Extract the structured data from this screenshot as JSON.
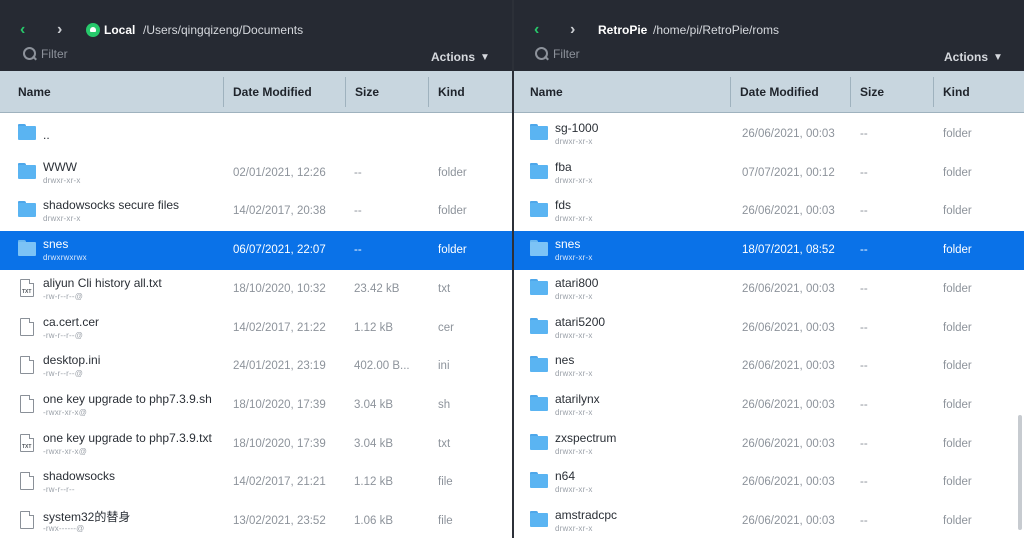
{
  "left": {
    "connection": "Local",
    "path": "/Users/qingqizeng/Documents",
    "filter_placeholder": "Filter",
    "actions_label": "Actions",
    "columns": [
      "Name",
      "Date Modified",
      "Size",
      "Kind"
    ],
    "rows": [
      {
        "type": "folder",
        "name": "..",
        "perm": "",
        "date": "",
        "size": "",
        "kind": ""
      },
      {
        "type": "folder",
        "name": "WWW",
        "perm": "drwxr-xr-x",
        "date": "02/01/2021, 12:26",
        "size": "--",
        "kind": "folder"
      },
      {
        "type": "folder",
        "name": "shadowsocks secure files",
        "perm": "drwxr-xr-x",
        "date": "14/02/2017, 20:38",
        "size": "--",
        "kind": "folder"
      },
      {
        "type": "folder",
        "name": "snes",
        "perm": "drwxrwxrwx",
        "date": "06/07/2021, 22:07",
        "size": "--",
        "kind": "folder",
        "selected": true
      },
      {
        "type": "file",
        "tag": "TXT",
        "name": "aliyun Cli history all.txt",
        "perm": "-rw-r--r--@",
        "date": "18/10/2020, 10:32",
        "size": "23.42 kB",
        "kind": "txt"
      },
      {
        "type": "file",
        "tag": "",
        "name": "ca.cert.cer",
        "perm": "-rw-r--r--@",
        "date": "14/02/2017, 21:22",
        "size": "1.12 kB",
        "kind": "cer"
      },
      {
        "type": "file",
        "tag": "",
        "name": "desktop.ini",
        "perm": "-rw-r--r--@",
        "date": "24/01/2021, 23:19",
        "size": "402.00 B...",
        "kind": "ini"
      },
      {
        "type": "file",
        "tag": "",
        "name": "one key upgrade to php7.3.9.sh",
        "perm": "-rwxr-xr-x@",
        "date": "18/10/2020, 17:39",
        "size": "3.04 kB",
        "kind": "sh"
      },
      {
        "type": "file",
        "tag": "TXT",
        "name": "one key upgrade to php7.3.9.txt",
        "perm": "-rwxr-xr-x@",
        "date": "18/10/2020, 17:39",
        "size": "3.04 kB",
        "kind": "txt"
      },
      {
        "type": "file",
        "tag": "",
        "name": "shadowsocks",
        "perm": "-rw-r--r--",
        "date": "14/02/2017, 21:21",
        "size": "1.12 kB",
        "kind": "file"
      },
      {
        "type": "file",
        "tag": "",
        "name": "system32的替身",
        "perm": "-rwx------@",
        "date": "13/02/2021, 23:52",
        "size": "1.06 kB",
        "kind": "file"
      }
    ]
  },
  "right": {
    "connection": "RetroPie",
    "path": "/home/pi/RetroPie/roms",
    "filter_placeholder": "Filter",
    "actions_label": "Actions",
    "columns": [
      "Name",
      "Date Modified",
      "Size",
      "Kind"
    ],
    "rows": [
      {
        "type": "folder",
        "name": "sg-1000",
        "perm": "drwxr-xr-x",
        "date": "26/06/2021, 00:03",
        "size": "--",
        "kind": "folder"
      },
      {
        "type": "folder",
        "name": "fba",
        "perm": "drwxr-xr-x",
        "date": "07/07/2021, 00:12",
        "size": "--",
        "kind": "folder"
      },
      {
        "type": "folder",
        "name": "fds",
        "perm": "drwxr-xr-x",
        "date": "26/06/2021, 00:03",
        "size": "--",
        "kind": "folder"
      },
      {
        "type": "folder",
        "name": "snes",
        "perm": "drwxr-xr-x",
        "date": "18/07/2021, 08:52",
        "size": "--",
        "kind": "folder",
        "selected": true
      },
      {
        "type": "folder",
        "name": "atari800",
        "perm": "drwxr-xr-x",
        "date": "26/06/2021, 00:03",
        "size": "--",
        "kind": "folder"
      },
      {
        "type": "folder",
        "name": "atari5200",
        "perm": "drwxr-xr-x",
        "date": "26/06/2021, 00:03",
        "size": "--",
        "kind": "folder"
      },
      {
        "type": "folder",
        "name": "nes",
        "perm": "drwxr-xr-x",
        "date": "26/06/2021, 00:03",
        "size": "--",
        "kind": "folder"
      },
      {
        "type": "folder",
        "name": "atarilynx",
        "perm": "drwxr-xr-x",
        "date": "26/06/2021, 00:03",
        "size": "--",
        "kind": "folder"
      },
      {
        "type": "folder",
        "name": "zxspectrum",
        "perm": "drwxr-xr-x",
        "date": "26/06/2021, 00:03",
        "size": "--",
        "kind": "folder"
      },
      {
        "type": "folder",
        "name": "n64",
        "perm": "drwxr-xr-x",
        "date": "26/06/2021, 00:03",
        "size": "--",
        "kind": "folder"
      },
      {
        "type": "folder",
        "name": "amstradcpc",
        "perm": "drwxr-xr-x",
        "date": "26/06/2021, 00:03",
        "size": "--",
        "kind": "folder"
      }
    ]
  },
  "colors": {
    "topbar": "#262a33",
    "header": "#c8d6df",
    "selection": "#0a72e8",
    "accent_green": "#27c96b",
    "folder": "#5ab4f2"
  },
  "icons": {
    "back": "chevron-left-icon",
    "forward": "chevron-right-icon",
    "connection": "connection-status-icon",
    "filter": "search-icon",
    "actions": "chevron-down-icon",
    "folder": "folder-icon",
    "file": "file-icon"
  }
}
